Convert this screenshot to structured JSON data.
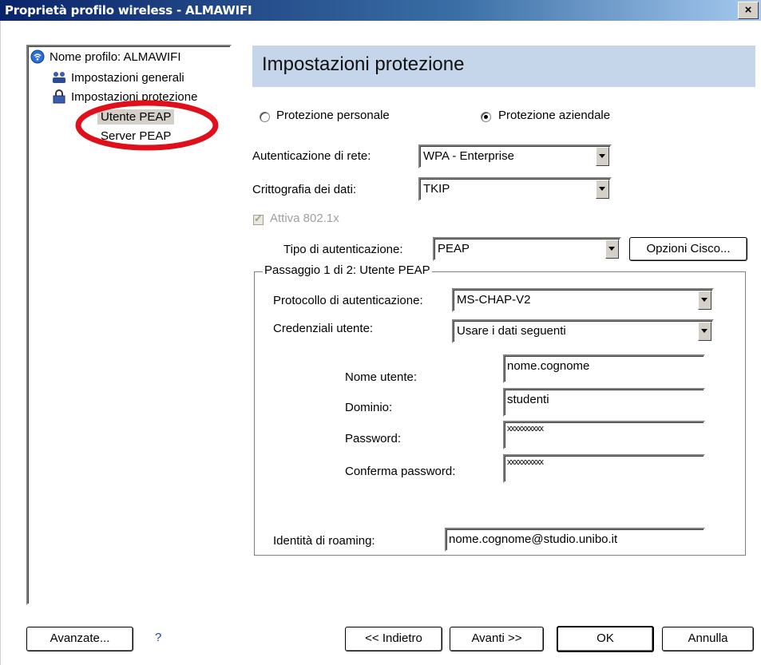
{
  "window": {
    "title": "Proprietà profilo wireless - ALMAWIFI",
    "close_label": "×"
  },
  "tree": {
    "items": [
      {
        "label": "Nome profilo: ALMAWIFI",
        "icon": "wireless-icon"
      },
      {
        "label": "Impostazioni generali",
        "icon": "users-icon"
      },
      {
        "label": "Impostazioni protezione",
        "icon": "lock-icon"
      },
      {
        "label": "Utente PEAP",
        "icon": ""
      },
      {
        "label": "Server PEAP",
        "icon": ""
      }
    ],
    "annotation_color": "#e0101a"
  },
  "header": {
    "title": "Impostazioni protezione",
    "bg_color": "#c5d5ea"
  },
  "protection": {
    "personal_label": "Protezione personale",
    "enterprise_label": "Protezione aziendale",
    "selected": "enterprise"
  },
  "network_auth": {
    "label": "Autenticazione di rete:",
    "value": "WPA - Enterprise"
  },
  "encryption": {
    "label": "Crittografia dei dati:",
    "value": "TKIP"
  },
  "dot1x": {
    "label": "Attiva 802.1x",
    "checked": true,
    "disabled": true
  },
  "auth_type": {
    "label": "Tipo di autenticazione:",
    "value": "PEAP",
    "cisco_button": "Opzioni Cisco..."
  },
  "step_group": {
    "legend": "Passaggio 1 di 2: Utente PEAP",
    "protocol_label": "Protocollo di autenticazione:",
    "protocol_value": "MS-CHAP-V2",
    "credentials_label": "Credenziali utente:",
    "credentials_value": "Usare i dati seguenti",
    "username_label": "Nome utente:",
    "username_value": "nome.cognome",
    "domain_label": "Dominio:",
    "domain_value": "studenti",
    "password_label": "Password:",
    "password_value": "xxxxxxxxxx",
    "confirm_label": "Conferma password:",
    "confirm_value": "xxxxxxxxxx",
    "roaming_label": "Identità di roaming:",
    "roaming_value": "nome.cognome@studio.unibo.it"
  },
  "footer": {
    "advanced": "Avanzate...",
    "help": "?",
    "back": "<< Indietro",
    "next": "Avanti >>",
    "ok": "OK",
    "cancel": "Annulla"
  }
}
